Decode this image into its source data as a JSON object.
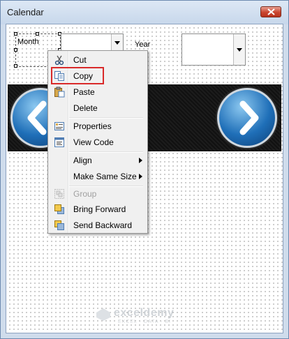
{
  "window": {
    "title": "Calendar"
  },
  "form": {
    "month_label": "Month",
    "year_label": "Year"
  },
  "menu": {
    "items": [
      {
        "label": "Cut",
        "icon": "scissors-icon"
      },
      {
        "label": "Copy",
        "icon": "copy-icon"
      },
      {
        "label": "Paste",
        "icon": "paste-icon"
      },
      {
        "label": "Delete",
        "icon": ""
      },
      {
        "label": "Properties",
        "icon": "properties-icon"
      },
      {
        "label": "View Code",
        "icon": "view-code-icon"
      },
      {
        "label": "Align",
        "icon": "",
        "submenu": true
      },
      {
        "label": "Make Same Size",
        "icon": "",
        "submenu": true
      },
      {
        "label": "Group",
        "icon": "group-icon",
        "disabled": true
      },
      {
        "label": "Bring Forward",
        "icon": "bring-forward-icon"
      },
      {
        "label": "Send Backward",
        "icon": "send-backward-icon"
      }
    ]
  },
  "watermark": {
    "brand": "exceldemy",
    "tagline": "EXCEL · DATA · BI"
  },
  "colors": {
    "highlight": "#d92a2a",
    "title_bar": "#cfdcec",
    "close_button": "#c9452f",
    "nav_button": "#1f6fb8"
  }
}
